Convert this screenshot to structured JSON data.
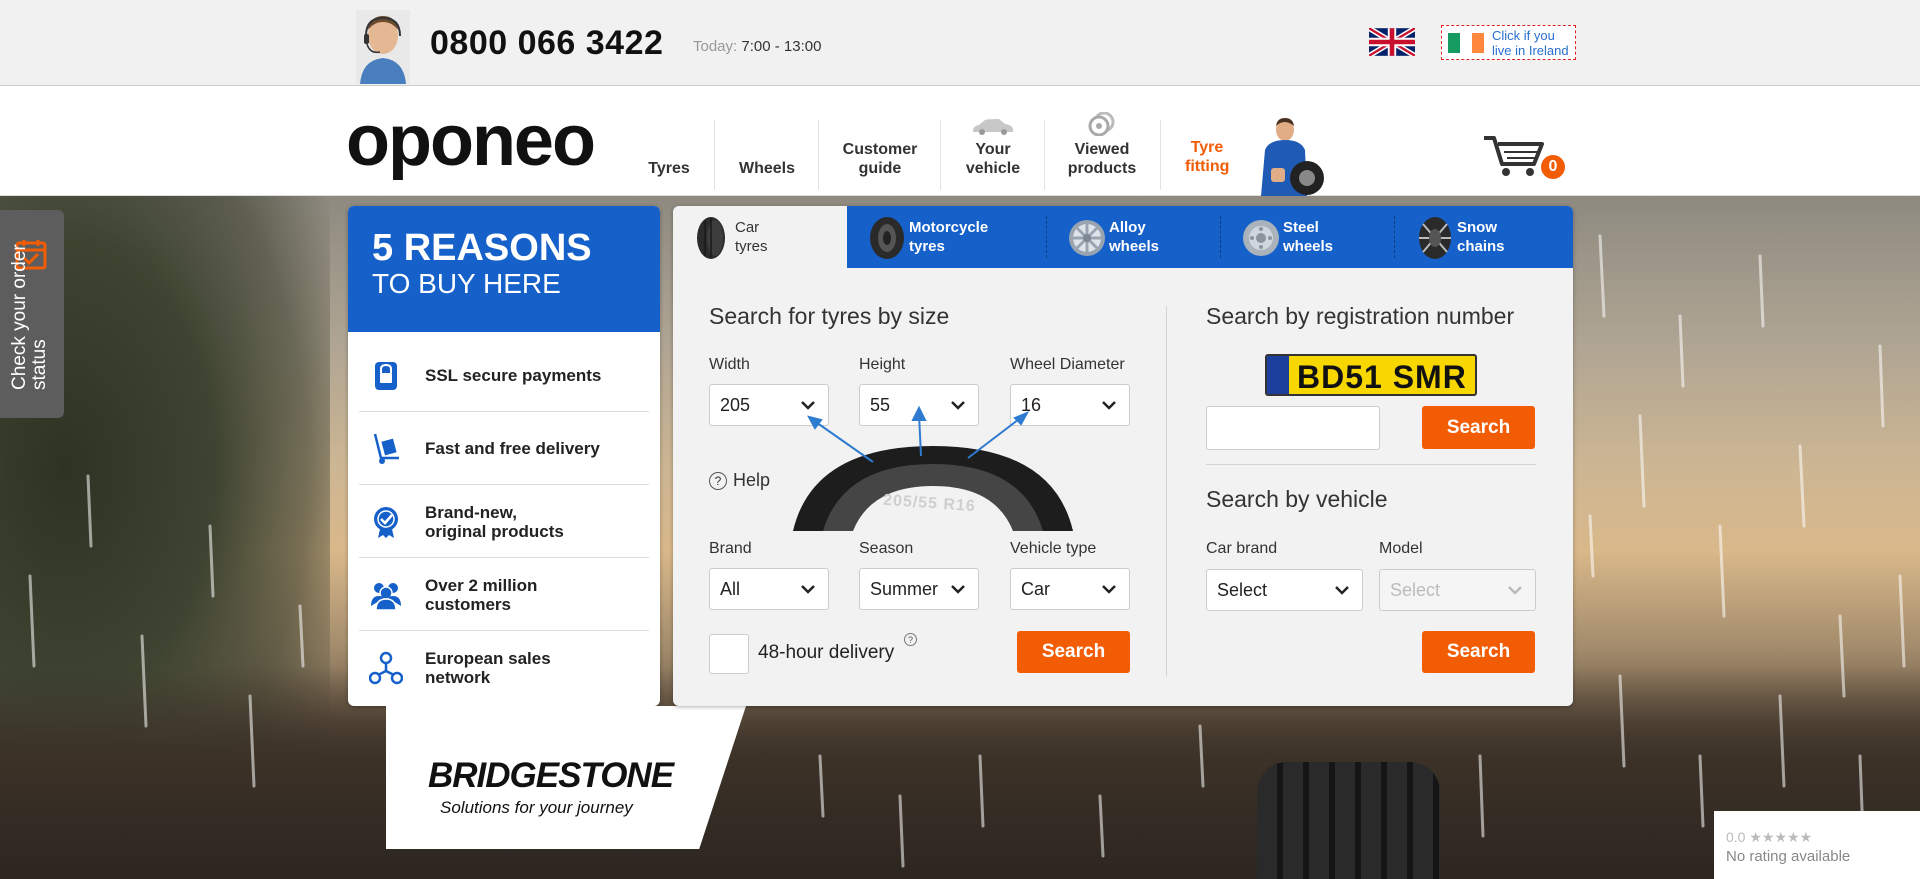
{
  "header": {
    "phone": "0800 066 3422",
    "today_label": "Today:",
    "today_hours": "7:00 - 13:00",
    "ireland_link": "Click if you live in Ireland"
  },
  "nav": {
    "logo": "oponeo",
    "items": [
      {
        "label": "Tyres"
      },
      {
        "label": "Wheels"
      },
      {
        "label": "Customer guide"
      },
      {
        "label": "Your vehicle"
      },
      {
        "label": "Viewed products"
      },
      {
        "label": "Tyre fitting"
      }
    ],
    "cart_count": "0"
  },
  "order_status": {
    "label": "Check your order status"
  },
  "reasons": {
    "title": "5 REASONS",
    "subtitle": "TO BUY HERE",
    "items": [
      {
        "label": "SSL secure payments",
        "icon": "lock-icon"
      },
      {
        "label": "Fast and free delivery",
        "icon": "trolley-icon"
      },
      {
        "label": "Brand-new, original products",
        "icon": "badge-check-icon"
      },
      {
        "label": "Over 2 million customers",
        "icon": "people-icon"
      },
      {
        "label": "European sales network",
        "icon": "network-icon"
      }
    ]
  },
  "tabs": [
    {
      "label": "Car tyres",
      "active": true
    },
    {
      "label": "Motorcycle tyres"
    },
    {
      "label": "Alloy wheels"
    },
    {
      "label": "Steel wheels"
    },
    {
      "label": "Snow chains"
    }
  ],
  "size_search": {
    "title": "Search for tyres by size",
    "width_label": "Width",
    "width_value": "205",
    "height_label": "Height",
    "height_value": "55",
    "diameter_label": "Wheel Diameter",
    "diameter_value": "16",
    "help_label": "Help",
    "tyre_marking": "205/55 R16",
    "brand_label": "Brand",
    "brand_value": "All",
    "season_label": "Season",
    "season_value": "Summer",
    "vehicle_type_label": "Vehicle type",
    "vehicle_type_value": "Car",
    "delivery_label": "48-hour delivery",
    "search_button": "Search"
  },
  "reg_search": {
    "title": "Search by registration number",
    "plate_text": "BD51 SMR",
    "search_button": "Search"
  },
  "vehicle_search": {
    "title": "Search by vehicle",
    "brand_label": "Car brand",
    "brand_value": "Select",
    "model_label": "Model",
    "model_value": "Select",
    "search_button": "Search"
  },
  "banner": {
    "brand": "BRIDGESTONE",
    "tagline": "Solutions for your journey"
  },
  "rating": {
    "score": "0.0",
    "text": "No rating available"
  },
  "colors": {
    "brand_blue": "#1660c9",
    "accent_orange": "#f25c05"
  }
}
